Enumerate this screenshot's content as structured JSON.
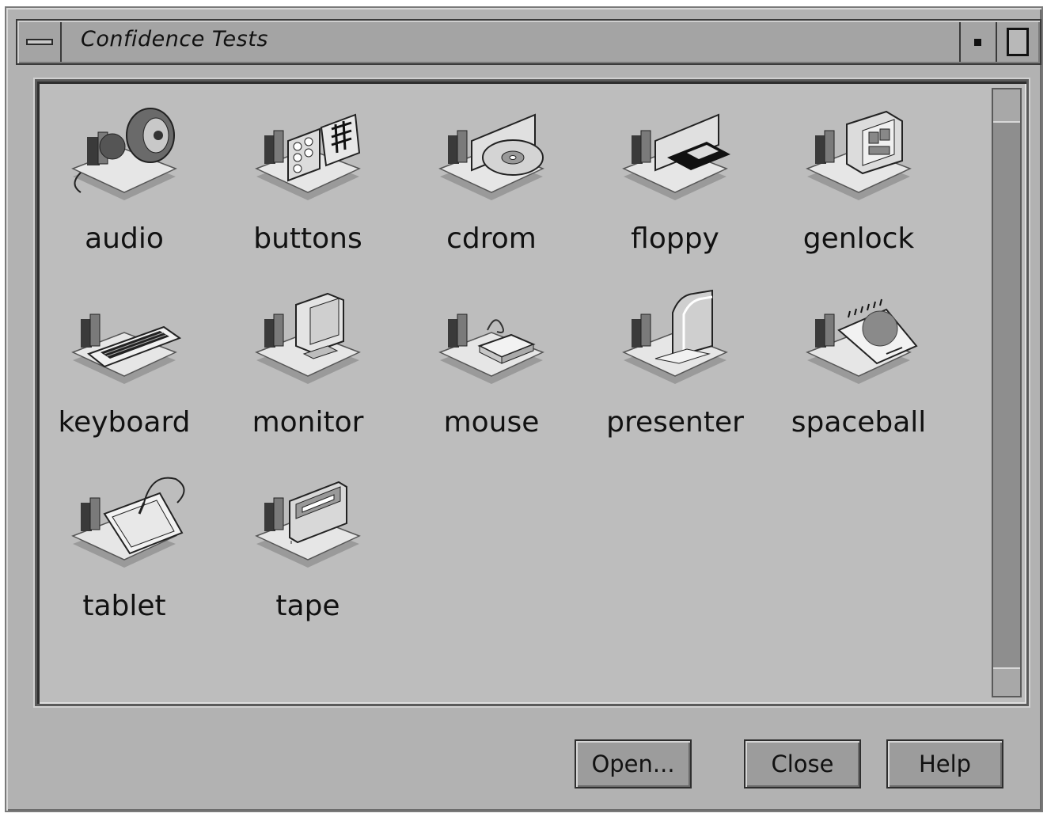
{
  "window": {
    "title": "Confidence Tests"
  },
  "icons": [
    {
      "label": "audio",
      "icon": "audio-icon"
    },
    {
      "label": "buttons",
      "icon": "buttons-icon"
    },
    {
      "label": "cdrom",
      "icon": "cdrom-icon"
    },
    {
      "label": "floppy",
      "icon": "floppy-icon"
    },
    {
      "label": "genlock",
      "icon": "genlock-icon"
    },
    {
      "label": "keyboard",
      "icon": "keyboard-icon"
    },
    {
      "label": "monitor",
      "icon": "monitor-icon"
    },
    {
      "label": "mouse",
      "icon": "mouse-icon"
    },
    {
      "label": "presenter",
      "icon": "presenter-icon"
    },
    {
      "label": "spaceball",
      "icon": "spaceball-icon"
    },
    {
      "label": "tablet",
      "icon": "tablet-icon"
    },
    {
      "label": "tape",
      "icon": "tape-icon"
    }
  ],
  "buttons": {
    "open": "Open...",
    "close": "Close",
    "help": "Help"
  }
}
